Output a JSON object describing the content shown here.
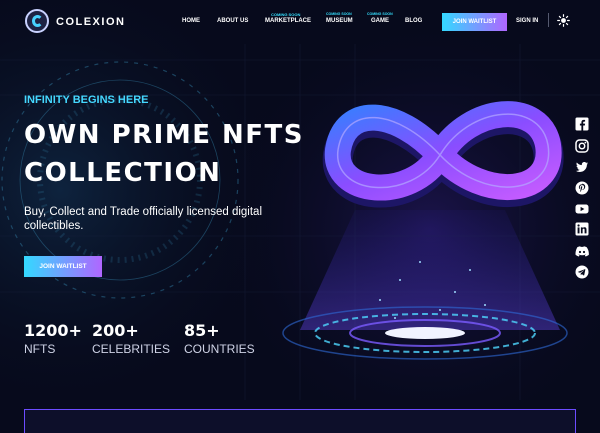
{
  "brand": {
    "name": "COLEXION"
  },
  "nav": {
    "home": "HOME",
    "about": "ABOUT US",
    "marketplace": "MARKETPLACE",
    "museum": "MUSEUM",
    "game": "GAME",
    "blog": "BLOG",
    "marketplace_badge": "COMING SOON",
    "museum_badge": "COMING SOON",
    "game_badge": "COMING SOON",
    "join_waitlist": "JOIN WAITLIST",
    "sign_in": "SIGN IN"
  },
  "hero": {
    "eyebrow": "INFINITY BEGINS HERE",
    "title_line1": "OWN PRIME NFTS",
    "title_line2": "COLLECTION",
    "description": "Buy, Collect and Trade officially licensed digital collectibles.",
    "cta": "JOIN WAITLIST"
  },
  "stats": [
    {
      "value": "1200+",
      "label": "NFTS"
    },
    {
      "value": "200+",
      "label": "CELEBRITIES"
    },
    {
      "value": "85+",
      "label": "COUNTRIES"
    }
  ],
  "social_icons": [
    "facebook-icon",
    "instagram-icon",
    "twitter-icon",
    "pinterest-icon",
    "youtube-icon",
    "linkedin-icon",
    "discord-icon",
    "telegram-icon"
  ],
  "colors": {
    "accent_cyan": "#45d8ff",
    "accent_purple": "#b066ff",
    "background": "#070a1c"
  }
}
